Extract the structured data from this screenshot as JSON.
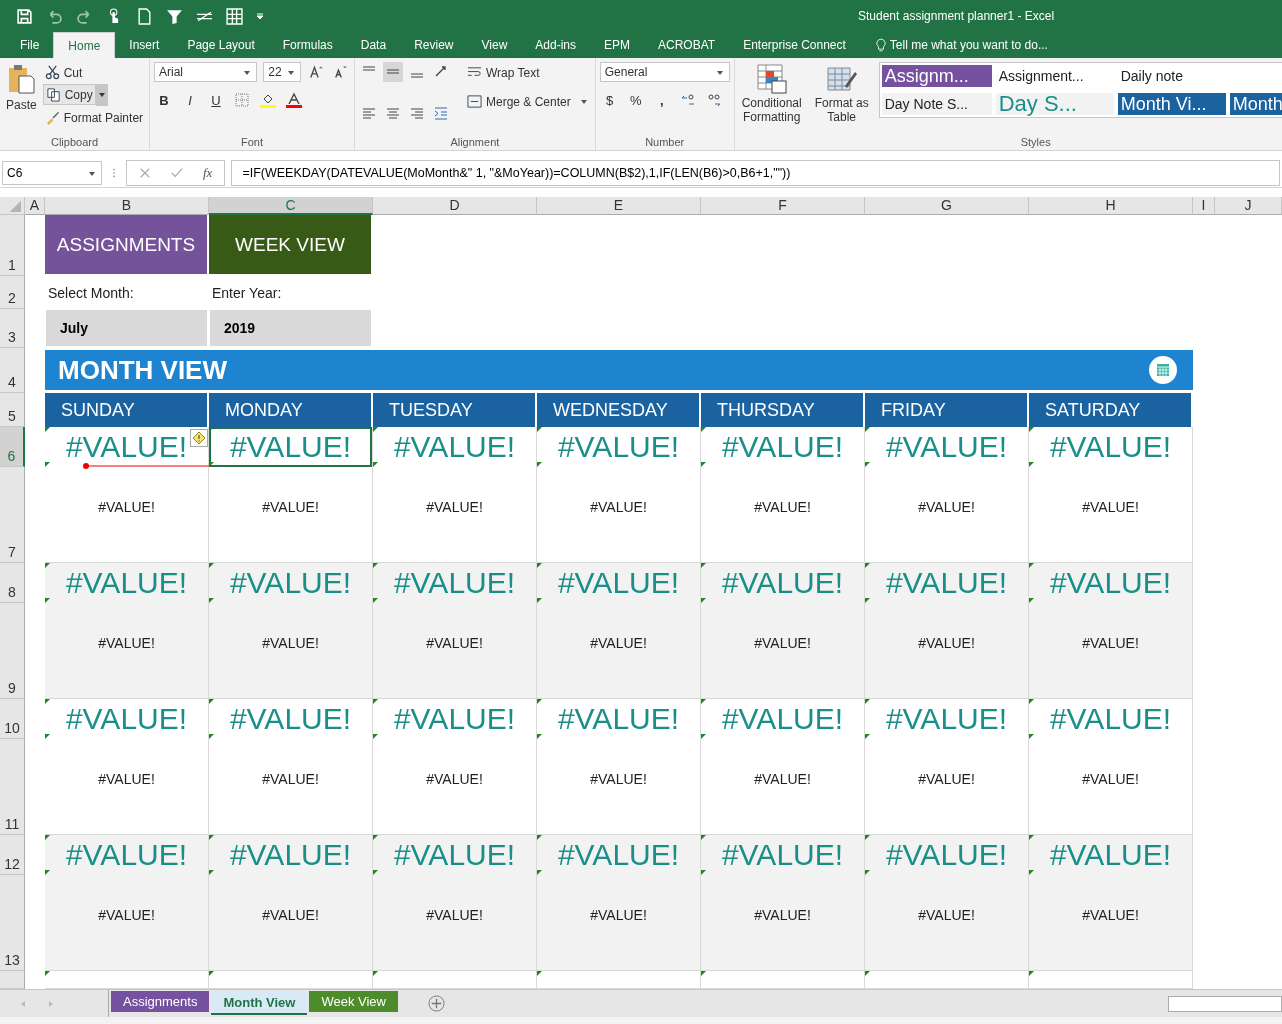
{
  "title_bar": {
    "title": "Student assignment planner1 - Excel"
  },
  "ribbon_tabs": [
    {
      "label": "File",
      "selected": false
    },
    {
      "label": "Home",
      "selected": true
    },
    {
      "label": "Insert",
      "selected": false
    },
    {
      "label": "Page Layout",
      "selected": false
    },
    {
      "label": "Formulas",
      "selected": false
    },
    {
      "label": "Data",
      "selected": false
    },
    {
      "label": "Review",
      "selected": false
    },
    {
      "label": "View",
      "selected": false
    },
    {
      "label": "Add-ins",
      "selected": false
    },
    {
      "label": "EPM",
      "selected": false
    },
    {
      "label": "ACROBAT",
      "selected": false
    },
    {
      "label": "Enterprise Connect",
      "selected": false
    }
  ],
  "tell_me": {
    "placeholder": "Tell me what you want to do..."
  },
  "clipboard": {
    "paste": "Paste",
    "cut": "Cut",
    "copy": "Copy",
    "format_painter": "Format Painter",
    "label": "Clipboard"
  },
  "font": {
    "name": "Arial",
    "size": "22",
    "bold": "B",
    "italic": "I",
    "underline": "U",
    "label": "Font"
  },
  "alignment": {
    "wrap_text": "Wrap Text",
    "merge_center": "Merge & Center",
    "label": "Alignment"
  },
  "number": {
    "format": "General",
    "currency": "$",
    "percent": "%",
    "comma": ",",
    "label": "Number"
  },
  "styles": {
    "conditional_formatting": "Conditional Formatting",
    "format_as_table": "Format as Table",
    "label": "Styles",
    "gallery": [
      {
        "text": "Assignm...",
        "kind": "purple"
      },
      {
        "text": "Assignment...",
        "kind": "plain"
      },
      {
        "text": "Daily note",
        "kind": "plain"
      },
      {
        "text": "Day Note S...",
        "kind": "grey"
      },
      {
        "text": "Day S...",
        "kind": "teal"
      },
      {
        "text": "Month Vi...",
        "kind": "blue"
      },
      {
        "text": "Month",
        "kind": "blue"
      }
    ]
  },
  "formula_bar": {
    "name_box": "C6",
    "fx": "fx",
    "formula": "=IF(WEEKDAY(DATEVALUE(MoMonth&\" 1, \"&MoYear))=COLUMN(B$2),1,IF(LEN(B6)>0,B6+1,\"\"))"
  },
  "columns": [
    {
      "label": "A",
      "selected": false
    },
    {
      "label": "B",
      "selected": false
    },
    {
      "label": "C",
      "selected": true
    },
    {
      "label": "D",
      "selected": false
    },
    {
      "label": "E",
      "selected": false
    },
    {
      "label": "F",
      "selected": false
    },
    {
      "label": "G",
      "selected": false
    },
    {
      "label": "H",
      "selected": false
    },
    {
      "label": "I",
      "selected": false
    },
    {
      "label": "J",
      "selected": false
    }
  ],
  "rows": [
    {
      "label": "1",
      "selected": false
    },
    {
      "label": "2",
      "selected": false
    },
    {
      "label": "3",
      "selected": false
    },
    {
      "label": "4",
      "selected": false
    },
    {
      "label": "5",
      "selected": false
    },
    {
      "label": "6",
      "selected": true
    },
    {
      "label": "7",
      "selected": false
    },
    {
      "label": "8",
      "selected": false
    },
    {
      "label": "9",
      "selected": false
    },
    {
      "label": "10",
      "selected": false
    },
    {
      "label": "11",
      "selected": false
    },
    {
      "label": "12",
      "selected": false
    },
    {
      "label": "13",
      "selected": false
    }
  ],
  "sheet": {
    "nav_buttons": [
      {
        "label": "ASSIGNMENTS",
        "kind": "assignments"
      },
      {
        "label": "WEEK VIEW",
        "kind": "week"
      }
    ],
    "month_label": "Select Month:",
    "month_value": "July",
    "year_label": "Enter Year:",
    "year_value": "2019",
    "banner": "MONTH VIEW",
    "days": [
      "SUNDAY",
      "MONDAY",
      "TUESDAY",
      "WEDNESDAY",
      "THURSDAY",
      "FRIDAY",
      "SATURDAY"
    ],
    "weeks": [
      [
        {
          "date": "#VALUE!",
          "note": "#VALUE!",
          "selected": false
        },
        {
          "date": "#VALUE!",
          "note": "#VALUE!",
          "selected": true
        },
        {
          "date": "#VALUE!",
          "note": "#VALUE!",
          "selected": false
        },
        {
          "date": "#VALUE!",
          "note": "#VALUE!",
          "selected": false
        },
        {
          "date": "#VALUE!",
          "note": "#VALUE!",
          "selected": false
        },
        {
          "date": "#VALUE!",
          "note": "#VALUE!",
          "selected": false
        },
        {
          "date": "#VALUE!",
          "note": "#VALUE!",
          "selected": false
        }
      ],
      [
        {
          "date": "#VALUE!",
          "note": "#VALUE!",
          "selected": false
        },
        {
          "date": "#VALUE!",
          "note": "#VALUE!",
          "selected": false
        },
        {
          "date": "#VALUE!",
          "note": "#VALUE!",
          "selected": false
        },
        {
          "date": "#VALUE!",
          "note": "#VALUE!",
          "selected": false
        },
        {
          "date": "#VALUE!",
          "note": "#VALUE!",
          "selected": false
        },
        {
          "date": "#VALUE!",
          "note": "#VALUE!",
          "selected": false
        },
        {
          "date": "#VALUE!",
          "note": "#VALUE!",
          "selected": false
        }
      ],
      [
        {
          "date": "#VALUE!",
          "note": "#VALUE!",
          "selected": false
        },
        {
          "date": "#VALUE!",
          "note": "#VALUE!",
          "selected": false
        },
        {
          "date": "#VALUE!",
          "note": "#VALUE!",
          "selected": false
        },
        {
          "date": "#VALUE!",
          "note": "#VALUE!",
          "selected": false
        },
        {
          "date": "#VALUE!",
          "note": "#VALUE!",
          "selected": false
        },
        {
          "date": "#VALUE!",
          "note": "#VALUE!",
          "selected": false
        },
        {
          "date": "#VALUE!",
          "note": "#VALUE!",
          "selected": false
        }
      ],
      [
        {
          "date": "#VALUE!",
          "note": "#VALUE!",
          "selected": false
        },
        {
          "date": "#VALUE!",
          "note": "#VALUE!",
          "selected": false
        },
        {
          "date": "#VALUE!",
          "note": "#VALUE!",
          "selected": false
        },
        {
          "date": "#VALUE!",
          "note": "#VALUE!",
          "selected": false
        },
        {
          "date": "#VALUE!",
          "note": "#VALUE!",
          "selected": false
        },
        {
          "date": "#VALUE!",
          "note": "#VALUE!",
          "selected": false
        },
        {
          "date": "#VALUE!",
          "note": "#VALUE!",
          "selected": false
        }
      ]
    ]
  },
  "sheet_tabs": [
    {
      "label": "Assignments",
      "color": "#7651a0",
      "selected": false
    },
    {
      "label": "Month View",
      "color": "#d9eaf7",
      "selected": true
    },
    {
      "label": "Week View",
      "color": "#4e8b2b",
      "selected": false
    }
  ]
}
